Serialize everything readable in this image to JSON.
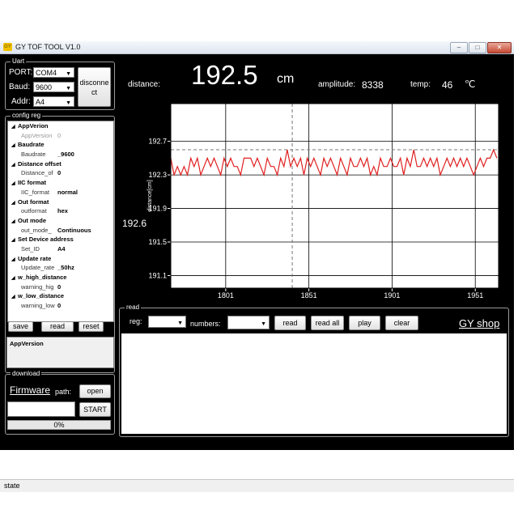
{
  "window": {
    "title": "GY TOF TOOL V1.0",
    "app_icon": "GY"
  },
  "uart": {
    "title": "Uart",
    "port_label": "PORT:",
    "port_value": "COM4",
    "baud_label": "Baud:",
    "baud_value": "9600",
    "addr_label": "Addr:",
    "addr_value": "A4",
    "disconnect_label": "disconne ct"
  },
  "config": {
    "title": "config reg",
    "rows": [
      {
        "kind": "cat",
        "name": "AppVerion"
      },
      {
        "kind": "item",
        "name": "AppVersion",
        "value": "0",
        "dim": true
      },
      {
        "kind": "cat",
        "name": "Baudrate"
      },
      {
        "kind": "item",
        "name": "Baudrate",
        "value": "_9600"
      },
      {
        "kind": "cat",
        "name": "Distance offset"
      },
      {
        "kind": "item",
        "name": "Distance_of",
        "value": "0"
      },
      {
        "kind": "cat",
        "name": "IIC format"
      },
      {
        "kind": "item",
        "name": "IIC_format",
        "value": "normal"
      },
      {
        "kind": "cat",
        "name": "Out format"
      },
      {
        "kind": "item",
        "name": "outformat",
        "value": "hex"
      },
      {
        "kind": "cat",
        "name": "Out mode"
      },
      {
        "kind": "item",
        "name": "out_mode_",
        "value": "Continuous"
      },
      {
        "kind": "cat",
        "name": "Set Device address"
      },
      {
        "kind": "item",
        "name": "Set_ID",
        "value": "A4"
      },
      {
        "kind": "cat",
        "name": "Update rate"
      },
      {
        "kind": "item",
        "name": "Update_rate",
        "value": "_50hz"
      },
      {
        "kind": "cat",
        "name": "w_high_distance"
      },
      {
        "kind": "item",
        "name": "warning_hig",
        "value": "0"
      },
      {
        "kind": "cat",
        "name": "w_low_distance"
      },
      {
        "kind": "item",
        "name": "warning_low",
        "value": "0"
      }
    ],
    "save_label": "save",
    "read_label": "read",
    "reset_label": "reset",
    "description": "AppVersion"
  },
  "download": {
    "title": "download",
    "firmware_label": "Firmware",
    "path_label": "path:",
    "open_label": "open",
    "start_label": "START",
    "progress_text": "0%",
    "progress": 0
  },
  "readout": {
    "distance_label": "distance:",
    "distance_value": "192.5",
    "distance_unit": "cm",
    "amplitude_label": "amplitude:",
    "amplitude_value": "8338",
    "temp_label": "temp:",
    "temp_value": "46",
    "temp_unit": "℃",
    "cursor_value": "192.6"
  },
  "read_panel": {
    "title": "read",
    "reg_label": "reg:",
    "numbers_label": "numbers:",
    "read_label": "read",
    "read_all_label": "read all",
    "play_label": "play",
    "clear_label": "clear",
    "shop_link": "GY shop"
  },
  "status": {
    "text": "state"
  },
  "chart_data": {
    "type": "line",
    "xlim": [
      1768,
      1965
    ],
    "ylim": [
      190.95,
      193.15
    ],
    "xticks": [
      1801,
      1851,
      1901,
      1951
    ],
    "yticks": [
      191.1,
      191.5,
      191.9,
      192.3,
      192.7
    ],
    "ylabel": "distance[cm]",
    "cursor_x": 1841,
    "cursor_y": 192.6,
    "grid": true,
    "series": [
      {
        "color": "#e02020",
        "x": [
          1768,
          1770,
          1772,
          1774,
          1776,
          1778,
          1780,
          1782,
          1784,
          1786,
          1788,
          1790,
          1792,
          1794,
          1796,
          1798,
          1800,
          1802,
          1804,
          1806,
          1808,
          1810,
          1812,
          1814,
          1816,
          1818,
          1820,
          1822,
          1824,
          1826,
          1828,
          1830,
          1832,
          1834,
          1836,
          1838,
          1840,
          1842,
          1844,
          1846,
          1848,
          1850,
          1852,
          1854,
          1856,
          1858,
          1860,
          1862,
          1864,
          1866,
          1868,
          1870,
          1872,
          1874,
          1876,
          1878,
          1880,
          1882,
          1884,
          1886,
          1888,
          1890,
          1892,
          1894,
          1896,
          1898,
          1900,
          1902,
          1904,
          1906,
          1908,
          1910,
          1912,
          1914,
          1916,
          1918,
          1920,
          1922,
          1924,
          1926,
          1928,
          1930,
          1932,
          1934,
          1936,
          1938,
          1940,
          1942,
          1944,
          1946,
          1948,
          1950,
          1952,
          1954,
          1956,
          1958,
          1960,
          1962,
          1964
        ],
        "y": [
          192.5,
          192.3,
          192.4,
          192.3,
          192.4,
          192.3,
          192.5,
          192.4,
          192.5,
          192.3,
          192.4,
          192.5,
          192.4,
          192.5,
          192.4,
          192.3,
          192.5,
          192.4,
          192.5,
          192.4,
          192.4,
          192.3,
          192.5,
          192.5,
          192.5,
          192.4,
          192.5,
          192.4,
          192.3,
          192.5,
          192.4,
          192.4,
          192.3,
          192.5,
          192.4,
          192.6,
          192.4,
          192.5,
          192.4,
          192.5,
          192.3,
          192.5,
          192.4,
          192.5,
          192.4,
          192.3,
          192.5,
          192.4,
          192.5,
          192.4,
          192.3,
          192.5,
          192.4,
          192.3,
          192.5,
          192.4,
          192.4,
          192.5,
          192.4,
          192.5,
          192.3,
          192.4,
          192.3,
          192.5,
          192.4,
          192.4,
          192.5,
          192.4,
          192.4,
          192.5,
          192.3,
          192.5,
          192.4,
          192.6,
          192.4,
          192.4,
          192.5,
          192.4,
          192.5,
          192.4,
          192.5,
          192.3,
          192.4,
          192.5,
          192.4,
          192.5,
          192.4,
          192.5,
          192.4,
          192.5,
          192.4,
          192.3,
          192.4,
          192.5,
          192.4,
          192.5,
          192.5,
          192.6,
          192.5
        ]
      }
    ]
  }
}
